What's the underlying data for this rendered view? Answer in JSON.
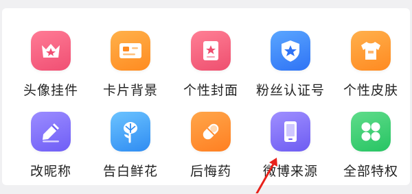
{
  "grid": {
    "items": [
      {
        "label": "头像挂件",
        "icon": "crown-frame-icon",
        "color_a": "#ff7b95",
        "color_b": "#f04f73"
      },
      {
        "label": "卡片背景",
        "icon": "card-image-icon",
        "color_a": "#ffb14a",
        "color_b": "#ff8b21"
      },
      {
        "label": "个性封面",
        "icon": "star-book-icon",
        "color_a": "#ff7f95",
        "color_b": "#ee4f6f"
      },
      {
        "label": "粉丝认证号",
        "icon": "shield-star-icon",
        "color_a": "#5aa6ff",
        "color_b": "#2f73f5"
      },
      {
        "label": "个性皮肤",
        "icon": "tshirt-icon",
        "color_a": "#ffb04c",
        "color_b": "#ff8a21"
      },
      {
        "label": "改昵称",
        "icon": "pencil-icon",
        "color_a": "#9b8cff",
        "color_b": "#6f5ef6"
      },
      {
        "label": "告白鲜花",
        "icon": "flower-icon",
        "color_a": "#6bc3ff",
        "color_b": "#2f8cf2"
      },
      {
        "label": "后悔药",
        "icon": "capsule-icon",
        "color_a": "#ffa64a",
        "color_b": "#ff7f22"
      },
      {
        "label": "微博来源",
        "icon": "phone-icon",
        "color_a": "#9f8fff",
        "color_b": "#6d5cf2"
      },
      {
        "label": "全部特权",
        "icon": "four-dots-icon",
        "color_a": "#5fdc8a",
        "color_b": "#27c463"
      }
    ]
  },
  "annotation": {
    "arrow_color": "#e8221b"
  }
}
